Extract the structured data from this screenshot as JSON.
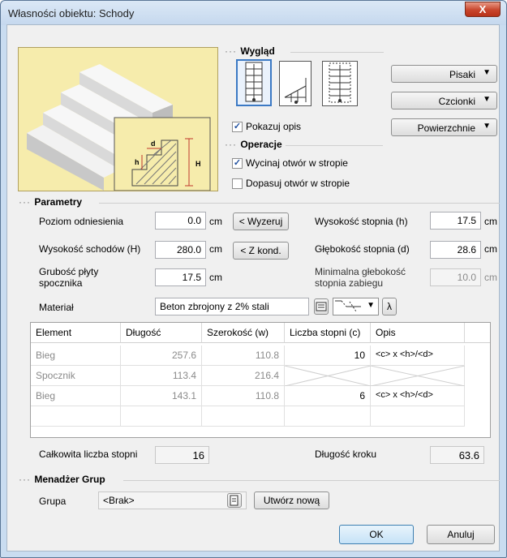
{
  "window": {
    "title": "Własności obiektu: Schody",
    "close_label": "X"
  },
  "appearance": {
    "title": "Wygląd",
    "icons": [
      "straight-stair-icon",
      "landing-stair-icon",
      "dual-flight-stair-icon"
    ],
    "show_description_label": "Pokazuj opis",
    "show_description_checked": true,
    "buttons": {
      "pens": "Pisaki",
      "fonts": "Czcionki",
      "surfaces": "Powierzchnie"
    }
  },
  "operations": {
    "title": "Operacje",
    "cut_opening_label": "Wycinaj otwór w stropie",
    "cut_opening_checked": true,
    "fit_opening_label": "Dopasuj otwór w stropie",
    "fit_opening_checked": false
  },
  "preview": {
    "label_h": "h",
    "label_d": "d",
    "label_H": "H"
  },
  "params": {
    "title": "Parametry",
    "ref_level_label": "Poziom odniesienia",
    "ref_level_value": "0.0",
    "stairs_height_label": "Wysokość schodów (H)",
    "stairs_height_value": "280.0",
    "landing_thickness_label": "Grubość płyty spocznika",
    "landing_thickness_value": "17.5",
    "unit": "cm",
    "reset_button": "< Wyzeruj",
    "from_floor_button": "< Z kond.",
    "step_height_label": "Wysokość stopnia (h)",
    "step_height_value": "17.5",
    "step_depth_label": "Głębokość stopnia (d)",
    "step_depth_value": "28.6",
    "min_winder_depth_label": "Minimalna głebokość stopnia zabiegu",
    "min_winder_depth_value": "10.0",
    "material_label": "Materiał",
    "material_value": "Beton zbrojony z 2% stali",
    "lambda_button": "λ"
  },
  "table": {
    "headers": [
      "Element",
      "Długość",
      "Szerokość (w)",
      "Liczba stopni (c)",
      "Opis"
    ],
    "rows": [
      {
        "element": "Bieg",
        "length": "257.6",
        "width": "110.8",
        "steps": "10",
        "desc": "<c> x <h>/<d>"
      },
      {
        "element": "Spocznik",
        "length": "113.4",
        "width": "216.4",
        "steps": "",
        "desc": ""
      },
      {
        "element": "Bieg",
        "length": "143.1",
        "width": "110.8",
        "steps": "6",
        "desc": "<c> x <h>/<d>"
      }
    ]
  },
  "totals": {
    "total_steps_label": "Całkowita liczba stopni",
    "total_steps_value": "16",
    "step_length_label": "Długość kroku",
    "step_length_value": "63.6"
  },
  "groups": {
    "title": "Menadżer Grup",
    "group_label": "Grupa",
    "group_value": "<Brak>",
    "create_button": "Utwórz nową"
  },
  "footer": {
    "ok": "OK",
    "cancel": "Anuluj"
  }
}
